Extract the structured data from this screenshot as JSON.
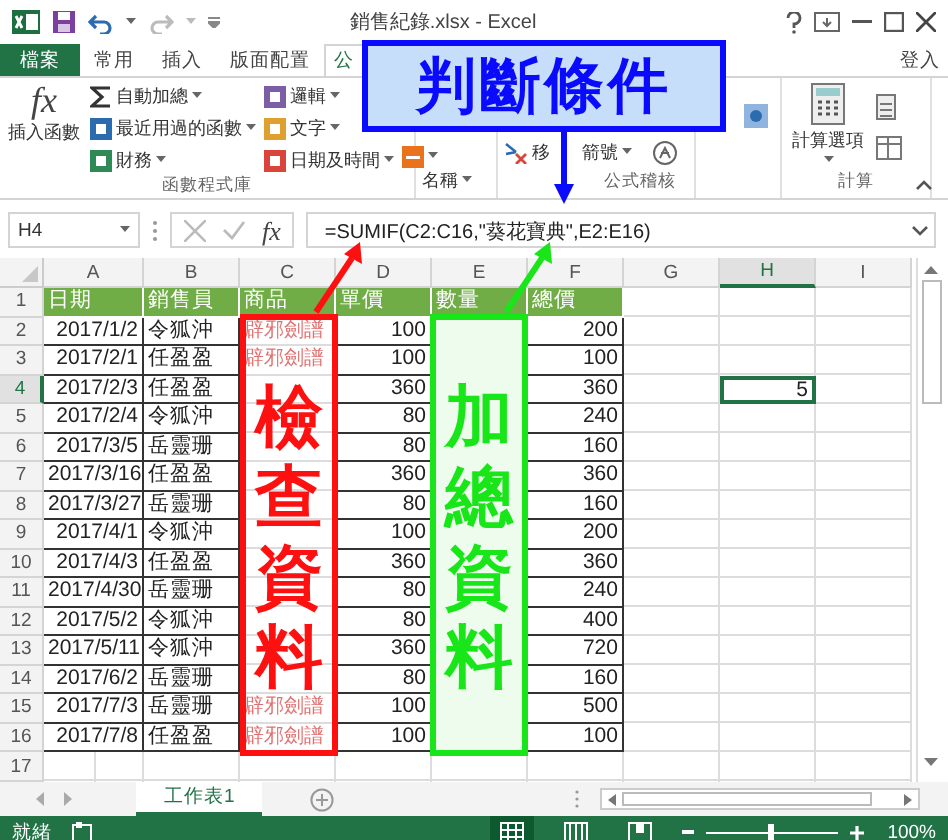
{
  "window": {
    "title": "銷售紀錄.xlsx - Excel"
  },
  "ribbon_tabs": [
    {
      "label": "檔案",
      "kind": "file",
      "selected": false
    },
    {
      "label": "常用",
      "kind": "tab",
      "selected": false
    },
    {
      "label": "插入",
      "kind": "tab",
      "selected": false
    },
    {
      "label": "版面配置",
      "kind": "tab",
      "selected": false
    },
    {
      "label": "公",
      "kind": "tab",
      "selected": true
    }
  ],
  "sign_in": "登入",
  "ribbon": {
    "fx_glyph": "fx",
    "insert_function": "插入函數",
    "library_left": [
      "自動加總",
      "最近用過的函數",
      "財務"
    ],
    "library_right": [
      "邏輯",
      "文字",
      "日期及時間"
    ],
    "library_label": "函數程式庫",
    "names": "名稱",
    "audit_remove_start": "移",
    "audit_remove_end": "箭號",
    "audit_label": "公式稽核",
    "calc_options": "計算選項",
    "calc_label": "計算"
  },
  "formula_bar": {
    "name_box": "H4",
    "fx_glyph": "fx",
    "formula": "=SUMIF(C2:C16,\"葵花寶典\",E2:E16)"
  },
  "column_headers": [
    {
      "label": "A",
      "selected": false
    },
    {
      "label": "B",
      "selected": false
    },
    {
      "label": "C",
      "selected": false
    },
    {
      "label": "D",
      "selected": false
    },
    {
      "label": "E",
      "selected": false
    },
    {
      "label": "F",
      "selected": false
    },
    {
      "label": "G",
      "selected": false
    },
    {
      "label": "H",
      "selected": true
    },
    {
      "label": "I",
      "selected": false
    }
  ],
  "row_headers": [
    {
      "label": "1",
      "selected": false
    },
    {
      "label": "2",
      "selected": false
    },
    {
      "label": "3",
      "selected": false
    },
    {
      "label": "4",
      "selected": true
    },
    {
      "label": "5",
      "selected": false
    },
    {
      "label": "6",
      "selected": false
    },
    {
      "label": "7",
      "selected": false
    },
    {
      "label": "8",
      "selected": false
    },
    {
      "label": "9",
      "selected": false
    },
    {
      "label": "10",
      "selected": false
    },
    {
      "label": "11",
      "selected": false
    },
    {
      "label": "12",
      "selected": false
    },
    {
      "label": "13",
      "selected": false
    },
    {
      "label": "14",
      "selected": false
    },
    {
      "label": "15",
      "selected": false
    },
    {
      "label": "16",
      "selected": false
    },
    {
      "label": "17",
      "selected": false
    }
  ],
  "table": {
    "columns": [
      "日期",
      "銷售員",
      "商品",
      "單價",
      "數量",
      "總價"
    ],
    "rows": [
      {
        "date": "2017/1/2",
        "seller": "令狐沖",
        "product": "辟邪劍譜",
        "price": "100",
        "total": "200"
      },
      {
        "date": "2017/2/1",
        "seller": "任盈盈",
        "product": "辟邪劍譜",
        "price": "100",
        "total": "100"
      },
      {
        "date": "2017/2/3",
        "seller": "任盈盈",
        "price": "360",
        "total": "360",
        "cell_h": {
          "value": "5",
          "selected": true
        }
      },
      {
        "date": "2017/2/4",
        "seller": "令狐沖",
        "price": "80",
        "total": "240"
      },
      {
        "date": "2017/3/5",
        "seller": "岳靈珊",
        "price": "80",
        "total": "160"
      },
      {
        "date": "2017/3/16",
        "seller": "任盈盈",
        "price": "360",
        "total": "360"
      },
      {
        "date": "2017/3/27",
        "seller": "岳靈珊",
        "price": "80",
        "total": "160"
      },
      {
        "date": "2017/4/1",
        "seller": "令狐沖",
        "price": "100",
        "total": "200"
      },
      {
        "date": "2017/4/3",
        "seller": "任盈盈",
        "price": "360",
        "total": "360"
      },
      {
        "date": "2017/4/30",
        "seller": "岳靈珊",
        "price": "80",
        "total": "240"
      },
      {
        "date": "2017/5/2",
        "seller": "令狐沖",
        "price": "80",
        "total": "400"
      },
      {
        "date": "2017/5/11",
        "seller": "令狐沖",
        "price": "360",
        "total": "720"
      },
      {
        "date": "2017/6/2",
        "seller": "岳靈珊",
        "price": "80",
        "total": "160"
      },
      {
        "date": "2017/7/3",
        "seller": "岳靈珊",
        "product": "辟邪劍譜",
        "price": "100",
        "total": "500"
      },
      {
        "date": "2017/7/8",
        "seller": "任盈盈",
        "product": "辟邪劍譜",
        "price": "100",
        "total": "100"
      }
    ]
  },
  "annotations": {
    "condition_callout": "判斷條件",
    "check_box": "檢查資料",
    "sum_box": "加總資料"
  },
  "sheet_tabs": [
    {
      "label": "工作表1",
      "selected": true
    }
  ],
  "status_bar": {
    "status": "就緒",
    "views": [
      {
        "kind": "normal",
        "selected": true
      },
      {
        "kind": "layout",
        "selected": false
      },
      {
        "kind": "break",
        "selected": false
      }
    ],
    "zoom": {
      "level": 0.5,
      "reading": "100%"
    }
  }
}
